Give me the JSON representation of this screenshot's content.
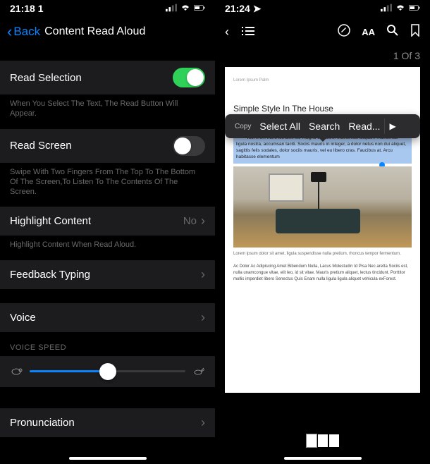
{
  "left": {
    "status": {
      "time": "21:18 1"
    },
    "nav": {
      "back": "Back",
      "title": "Content Read Aloud"
    },
    "readSelection": {
      "label": "Read Selection",
      "description": "When You Select The Text, The Read Button Will Appear."
    },
    "readScreen": {
      "label": "Read Screen",
      "description": "Swipe With Two Fingers From The Top To The Bottom Of The Screen,To Listen To The Contents Of The Screen."
    },
    "highlight": {
      "label": "Highlight Content",
      "value": "No",
      "description": "Highlight Content When Read Aloud."
    },
    "feedbackTyping": {
      "label": "Feedback Typing"
    },
    "voice": {
      "label": "Voice"
    },
    "voiceSpeed": {
      "header": "VOICE SPEED"
    },
    "pronunciation": {
      "label": "Pronunciation"
    }
  },
  "right": {
    "status": {
      "time": "21:24"
    },
    "pageIndicator": "1 Of 3",
    "doc": {
      "headerText": "Lorem Ipsum Palm",
      "title": "Simple Style In The House",
      "selectedText": "orem ipsum dolor sit amet, ligula suspendisse nulla pretium, rhoncus tempor fermentum, enim integer ad vestibulum volutpat. Nisl turpis est, vel elit, congue wisi enim nunc ultricies sit, magna tincidunt. Maecenas aliquam maecenas ligula nostra, accumsan taciti. Sociis mauris in integer, a dolor netus non dui aliquet, sagittis felis sodales, dolor sociis mauris, vel eu libero cras. Faucibus at. Arcu habitasse elementum",
      "caption": "Lorem ipsum dolor sit amet, ligula suspendisse nulla pretium, rhoncus tempor fermentum.",
      "body": "Ac Dolor Ac Adipiscing Amet Bibendum Nulla, Lacus Molestudin Id Pisa Nec aretta Sociis est, nulla unamcongue vitae, elit leo, id sit vitae. Mauris pretium aliquet, lectus tincidunt. Porttitor mollis imperdiet libero Senectus Quis Enam nulla ligula ligula aliquet vehicula exForest."
    },
    "contextMenu": {
      "copy": "Copy",
      "selectAll": "Select All",
      "search": "Search",
      "read": "Read..."
    }
  }
}
